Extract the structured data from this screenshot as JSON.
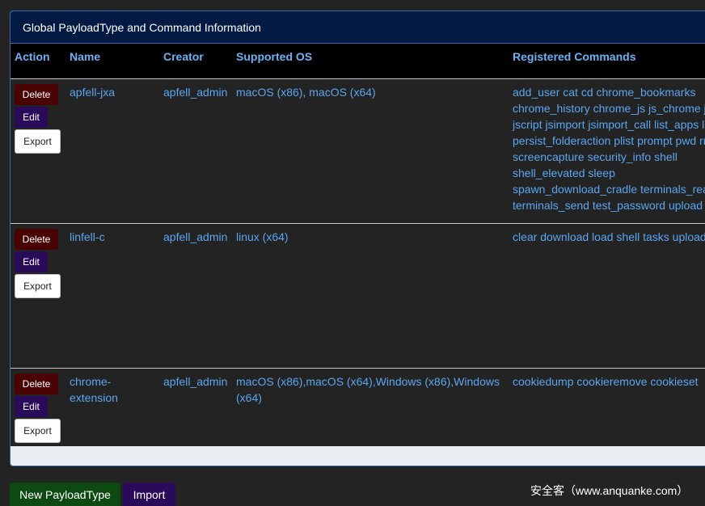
{
  "panel": {
    "title": "Global PayloadType and Command Information"
  },
  "table": {
    "headers": {
      "action": "Action",
      "name": "Name",
      "creator": "Creator",
      "os": "Supported OS",
      "commands": "Registered Commands"
    },
    "buttons": {
      "delete": "Delete",
      "edit": "Edit",
      "export": "Export"
    },
    "rows": [
      {
        "name": "apfell-jxa",
        "creator": "apfell_admin",
        "os": "macOS (x86), macOS (x64)",
        "commands": "add_user cat cd chrome_bookmarks chrome_history chrome_js js_chrome jsb jscript jsimport jsimport_call list_apps ls persist_folderaction plist prompt pwd rm screencapture security_info shell shell_elevated sleep spawn_download_cradle terminals_read terminals_send test_password upload"
      },
      {
        "name": "linfell-c",
        "creator": "apfell_admin",
        "os": "linux (x64)",
        "commands": "clear download load shell tasks upload"
      },
      {
        "name": "chrome-extension",
        "creator": "apfell_admin",
        "os": "macOS (x86),macOS (x64),Windows (x86),Windows (x64)",
        "commands": "cookiedump cookieremove cookieset"
      }
    ]
  },
  "footer": {
    "new_payloadtype": "New PayloadType",
    "import": "Import"
  },
  "watermark": "安全客（www.anquanke.com）"
}
